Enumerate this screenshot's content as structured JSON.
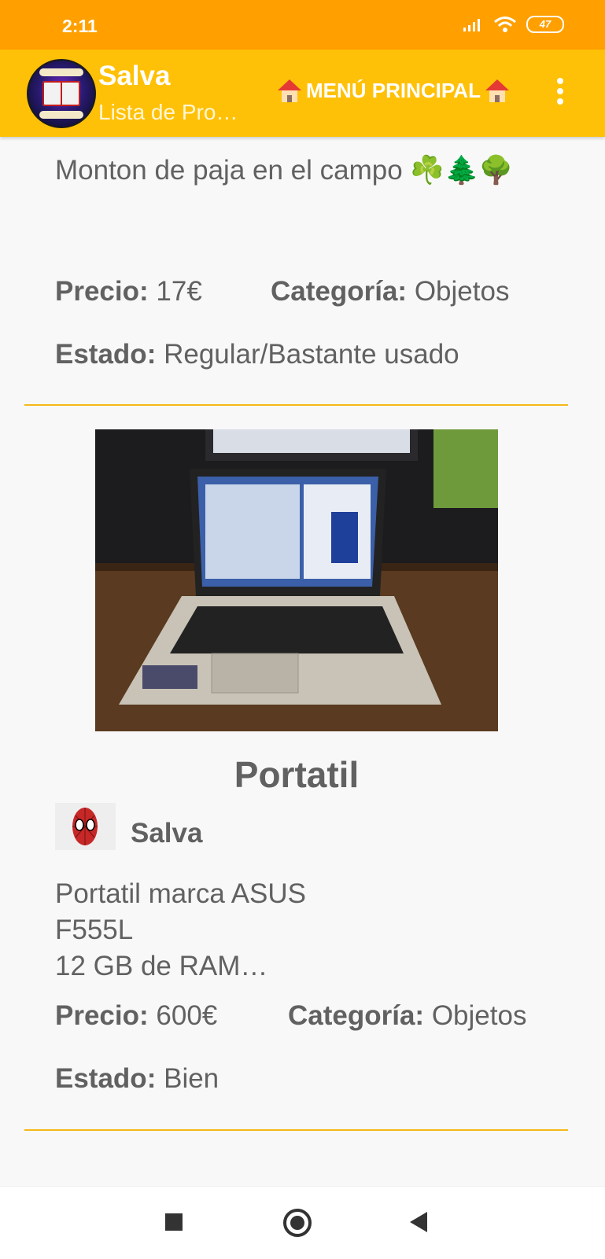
{
  "status_bar": {
    "time": "2:11",
    "battery": "47"
  },
  "app_bar": {
    "title": "Salva",
    "subtitle": "Lista de Pro…",
    "menu_label": "MENÚ PRINCIPAL",
    "menu_icon": "house-icon",
    "more_icon": "more-vert-icon"
  },
  "colors": {
    "status_bar": "#ffa000",
    "app_bar": "#ffc107",
    "divider": "#f6b81a"
  },
  "products": [
    {
      "description": "Monton de paja en el campo ☘️🌲🌳",
      "price_label": "Precio:",
      "price": "17€",
      "category_label": "Categoría:",
      "category": "Objetos",
      "state_label": "Estado:",
      "state": "Regular/Bastante usado"
    },
    {
      "title": "Portatil",
      "owner": "Salva",
      "owner_avatar": "spiderman-mask-icon",
      "description": "Portatil marca ASUS\nF555L\n12 GB de RAM…",
      "price_label": "Precio:",
      "price": "600€",
      "category_label": "Categoría:",
      "category": "Objetos",
      "state_label": "Estado:",
      "state": "Bien"
    }
  ],
  "nav": {
    "recents_icon": "square-icon",
    "home_icon": "circle-icon",
    "back_icon": "triangle-back-icon"
  }
}
